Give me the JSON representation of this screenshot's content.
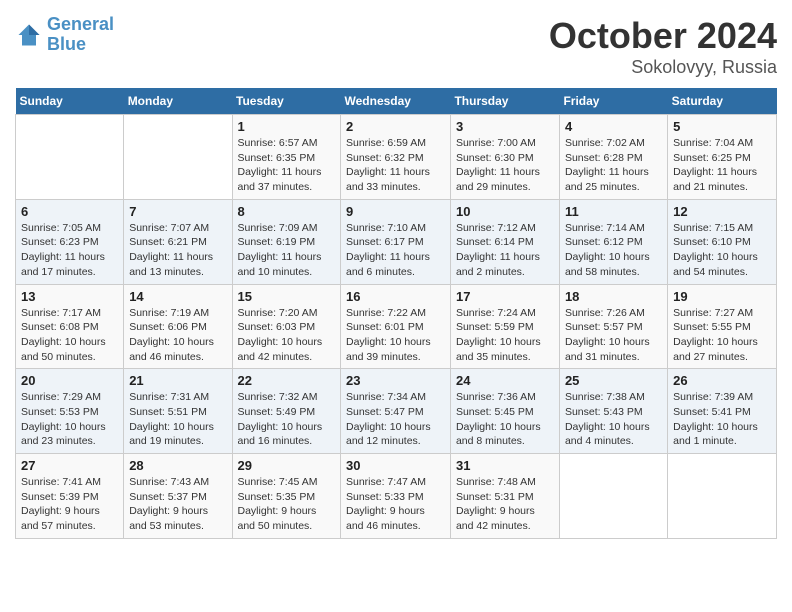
{
  "header": {
    "logo_general": "General",
    "logo_blue": "Blue",
    "month": "October 2024",
    "location": "Sokolovyy, Russia"
  },
  "days_of_week": [
    "Sunday",
    "Monday",
    "Tuesday",
    "Wednesday",
    "Thursday",
    "Friday",
    "Saturday"
  ],
  "weeks": [
    [
      {
        "day": "",
        "info": ""
      },
      {
        "day": "",
        "info": ""
      },
      {
        "day": "1",
        "info": "Sunrise: 6:57 AM\nSunset: 6:35 PM\nDaylight: 11 hours\nand 37 minutes."
      },
      {
        "day": "2",
        "info": "Sunrise: 6:59 AM\nSunset: 6:32 PM\nDaylight: 11 hours\nand 33 minutes."
      },
      {
        "day": "3",
        "info": "Sunrise: 7:00 AM\nSunset: 6:30 PM\nDaylight: 11 hours\nand 29 minutes."
      },
      {
        "day": "4",
        "info": "Sunrise: 7:02 AM\nSunset: 6:28 PM\nDaylight: 11 hours\nand 25 minutes."
      },
      {
        "day": "5",
        "info": "Sunrise: 7:04 AM\nSunset: 6:25 PM\nDaylight: 11 hours\nand 21 minutes."
      }
    ],
    [
      {
        "day": "6",
        "info": "Sunrise: 7:05 AM\nSunset: 6:23 PM\nDaylight: 11 hours\nand 17 minutes."
      },
      {
        "day": "7",
        "info": "Sunrise: 7:07 AM\nSunset: 6:21 PM\nDaylight: 11 hours\nand 13 minutes."
      },
      {
        "day": "8",
        "info": "Sunrise: 7:09 AM\nSunset: 6:19 PM\nDaylight: 11 hours\nand 10 minutes."
      },
      {
        "day": "9",
        "info": "Sunrise: 7:10 AM\nSunset: 6:17 PM\nDaylight: 11 hours\nand 6 minutes."
      },
      {
        "day": "10",
        "info": "Sunrise: 7:12 AM\nSunset: 6:14 PM\nDaylight: 11 hours\nand 2 minutes."
      },
      {
        "day": "11",
        "info": "Sunrise: 7:14 AM\nSunset: 6:12 PM\nDaylight: 10 hours\nand 58 minutes."
      },
      {
        "day": "12",
        "info": "Sunrise: 7:15 AM\nSunset: 6:10 PM\nDaylight: 10 hours\nand 54 minutes."
      }
    ],
    [
      {
        "day": "13",
        "info": "Sunrise: 7:17 AM\nSunset: 6:08 PM\nDaylight: 10 hours\nand 50 minutes."
      },
      {
        "day": "14",
        "info": "Sunrise: 7:19 AM\nSunset: 6:06 PM\nDaylight: 10 hours\nand 46 minutes."
      },
      {
        "day": "15",
        "info": "Sunrise: 7:20 AM\nSunset: 6:03 PM\nDaylight: 10 hours\nand 42 minutes."
      },
      {
        "day": "16",
        "info": "Sunrise: 7:22 AM\nSunset: 6:01 PM\nDaylight: 10 hours\nand 39 minutes."
      },
      {
        "day": "17",
        "info": "Sunrise: 7:24 AM\nSunset: 5:59 PM\nDaylight: 10 hours\nand 35 minutes."
      },
      {
        "day": "18",
        "info": "Sunrise: 7:26 AM\nSunset: 5:57 PM\nDaylight: 10 hours\nand 31 minutes."
      },
      {
        "day": "19",
        "info": "Sunrise: 7:27 AM\nSunset: 5:55 PM\nDaylight: 10 hours\nand 27 minutes."
      }
    ],
    [
      {
        "day": "20",
        "info": "Sunrise: 7:29 AM\nSunset: 5:53 PM\nDaylight: 10 hours\nand 23 minutes."
      },
      {
        "day": "21",
        "info": "Sunrise: 7:31 AM\nSunset: 5:51 PM\nDaylight: 10 hours\nand 19 minutes."
      },
      {
        "day": "22",
        "info": "Sunrise: 7:32 AM\nSunset: 5:49 PM\nDaylight: 10 hours\nand 16 minutes."
      },
      {
        "day": "23",
        "info": "Sunrise: 7:34 AM\nSunset: 5:47 PM\nDaylight: 10 hours\nand 12 minutes."
      },
      {
        "day": "24",
        "info": "Sunrise: 7:36 AM\nSunset: 5:45 PM\nDaylight: 10 hours\nand 8 minutes."
      },
      {
        "day": "25",
        "info": "Sunrise: 7:38 AM\nSunset: 5:43 PM\nDaylight: 10 hours\nand 4 minutes."
      },
      {
        "day": "26",
        "info": "Sunrise: 7:39 AM\nSunset: 5:41 PM\nDaylight: 10 hours\nand 1 minute."
      }
    ],
    [
      {
        "day": "27",
        "info": "Sunrise: 7:41 AM\nSunset: 5:39 PM\nDaylight: 9 hours\nand 57 minutes."
      },
      {
        "day": "28",
        "info": "Sunrise: 7:43 AM\nSunset: 5:37 PM\nDaylight: 9 hours\nand 53 minutes."
      },
      {
        "day": "29",
        "info": "Sunrise: 7:45 AM\nSunset: 5:35 PM\nDaylight: 9 hours\nand 50 minutes."
      },
      {
        "day": "30",
        "info": "Sunrise: 7:47 AM\nSunset: 5:33 PM\nDaylight: 9 hours\nand 46 minutes."
      },
      {
        "day": "31",
        "info": "Sunrise: 7:48 AM\nSunset: 5:31 PM\nDaylight: 9 hours\nand 42 minutes."
      },
      {
        "day": "",
        "info": ""
      },
      {
        "day": "",
        "info": ""
      }
    ]
  ]
}
